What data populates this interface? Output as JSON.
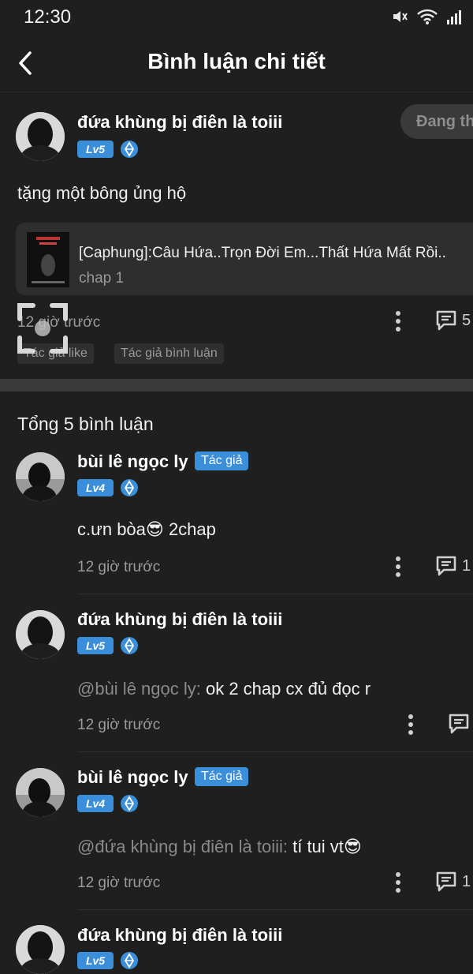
{
  "status": {
    "time": "12:30"
  },
  "header": {
    "title": "Bình luận chi tiết"
  },
  "main_comment": {
    "username": "đứa khùng bị điên là toiii",
    "level": "Lv5",
    "follow_label": "Đang th",
    "text": "tặng một bông ủng hộ",
    "story": {
      "title": "[Caphung]:Câu Hứa..Trọn Đời Em...Thất Hứa Mất Rồi..",
      "chapter": "chap 1"
    },
    "time": "12 giờ trước",
    "reply_count": "5",
    "tags": [
      "Tác giả like",
      "Tác giả bình luận"
    ]
  },
  "replies_section": {
    "total": "Tổng 5 bình luận"
  },
  "replies": [
    {
      "username": "bùi lê ngọc ly",
      "is_author": true,
      "author_label": "Tác giả",
      "level": "Lv4",
      "mention": "",
      "text": "c.ưn bòa😎 2chap",
      "time": "12 giờ trước",
      "reply_count": "1"
    },
    {
      "username": "đứa khùng bị điên là toiii",
      "is_author": false,
      "author_label": "",
      "level": "Lv5",
      "mention": "@bùi lê ngọc ly:",
      "text": " ok 2 chap cx đủ đọc r",
      "time": "12 giờ trước",
      "reply_count": ""
    },
    {
      "username": "bùi lê ngọc ly",
      "is_author": true,
      "author_label": "Tác giả",
      "level": "Lv4",
      "mention": "@đứa khùng bị điên là toiii:",
      "text": " tí tui vt😎",
      "time": "12 giờ trước",
      "reply_count": "1"
    },
    {
      "username": "đứa khùng bị điên là toiii",
      "is_author": false,
      "author_label": "",
      "level": "Lv5",
      "mention": "",
      "text": "",
      "time": "",
      "reply_count": ""
    }
  ],
  "colors": {
    "background": "#1f1f1f",
    "accent": "#3b8ed9",
    "muted": "#9a9a9a"
  },
  "icons": [
    "wifi-icon",
    "signal-icon",
    "mute-icon",
    "back-icon",
    "rank-icon",
    "more-icon",
    "reply-icon"
  ]
}
